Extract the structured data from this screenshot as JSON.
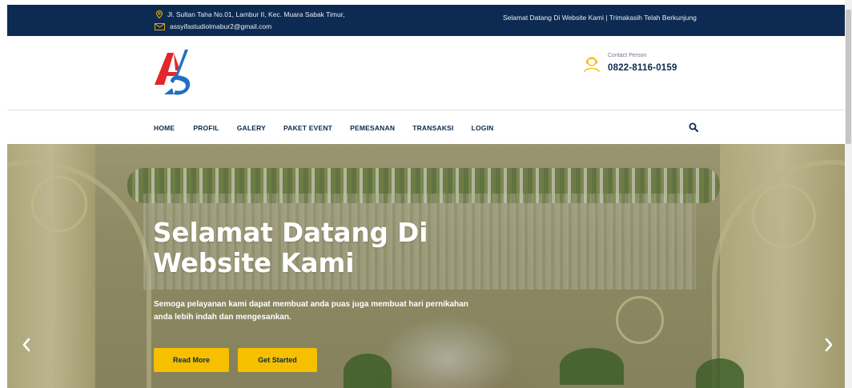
{
  "topbar": {
    "address": "Jl. Sultan Taha No.01, Lambur II, Kec. Muara Sabak Timur,",
    "email": "assyifastudiolmabur2@gmail.com",
    "welcome": "Selamat Datang Di Website Kami | Trimakasih Telah Berkunjung",
    "icons": {
      "address": "map-pin-icon",
      "email": "envelope-icon"
    },
    "colors": {
      "background": "#0d2b52",
      "accent": "#f5b600"
    }
  },
  "header": {
    "logo_text": "AS",
    "contact_label": "Contact Person",
    "contact_number": "0822-8116-0159",
    "icons": {
      "contact": "headset-icon"
    }
  },
  "nav": {
    "items": [
      {
        "label": "HOME"
      },
      {
        "label": "PROFIL"
      },
      {
        "label": "GALERY"
      },
      {
        "label": "PAKET EVENT"
      },
      {
        "label": "PEMESANAN"
      },
      {
        "label": "TRANSAKSI"
      },
      {
        "label": "LOGIN"
      }
    ],
    "search_icon": "search-icon"
  },
  "hero": {
    "title": "Selamat Datang Di Website Kami",
    "subtitle": "Semoga pelayanan kami dapat membuat anda puas juga membuat hari pernikahan anda lebih indah dan mengesankan.",
    "read_more_label": "Read More",
    "get_started_label": "Get Started",
    "prev_icon": "chevron-left-icon",
    "next_icon": "chevron-right-icon",
    "colors": {
      "button": "#f6c000",
      "text": "#ffffff"
    }
  }
}
